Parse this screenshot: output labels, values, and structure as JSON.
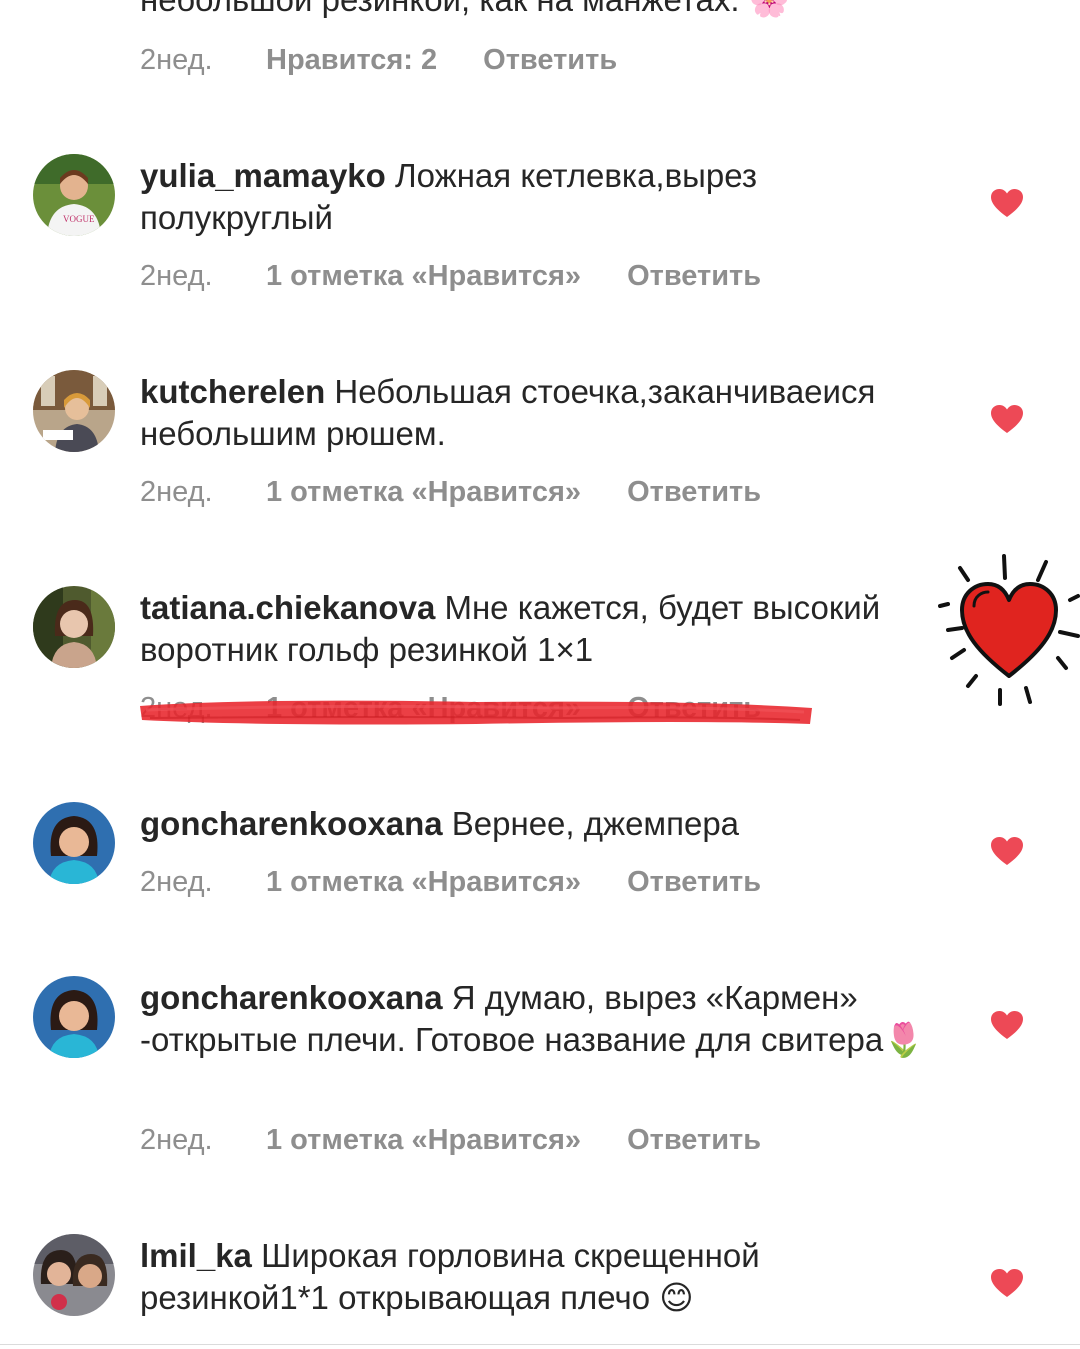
{
  "top_comment": {
    "text_tail": "небольшой резинкой, как на манжетах.",
    "emoji": "🌸",
    "time": "2нед.",
    "likes": "Нравится: 2",
    "reply": "Ответить"
  },
  "comments": [
    {
      "username": "yulia_mamayko",
      "text": "Ложная кетлевка,вырез полукруглый",
      "time": "2нед.",
      "likes": "1 отметка «Нравится»",
      "reply": "Ответить",
      "liked": true
    },
    {
      "username": "kutcherelen",
      "text": "Небольшая стоечка,заканчиваеися небольшим рюшем.",
      "time": "2нед.",
      "likes": "1 отметка «Нравится»",
      "reply": "Ответить",
      "liked": true
    },
    {
      "username": "tatiana.chiekanova",
      "text": "Мне кажется, будет высокий воротник гольф резинкой 1×1",
      "time": "2нед.",
      "likes": "1 отметка «Нравится»",
      "reply": "Ответить",
      "liked": true,
      "highlighted": true
    },
    {
      "username": "goncharenkooxana",
      "text": "Вернее, джемпера",
      "time": "2нед.",
      "likes": "1 отметка «Нравится»",
      "reply": "Ответить",
      "liked": true
    },
    {
      "username": "goncharenkooxana",
      "text": "Я думаю, вырез «Кармен» -открытые плечи. Готовое название для свитера",
      "emoji": "🌷",
      "time": "2нед.",
      "likes": "1 отметка «Нравится»",
      "reply": "Ответить",
      "liked": true
    },
    {
      "username": "lmil_ka",
      "text": "Широкая горловина скрещенной резинкой1*1 открывающая плечо",
      "emoji": "😊",
      "liked": true
    }
  ],
  "colors": {
    "heart": "#ed4956",
    "meta_text": "#8e8e8e",
    "highlight_marker": "#e8242b",
    "sticker_heart": "#e0241f"
  },
  "icons": [
    "heart-icon",
    "heart-sticker-icon",
    "avatar-image"
  ]
}
